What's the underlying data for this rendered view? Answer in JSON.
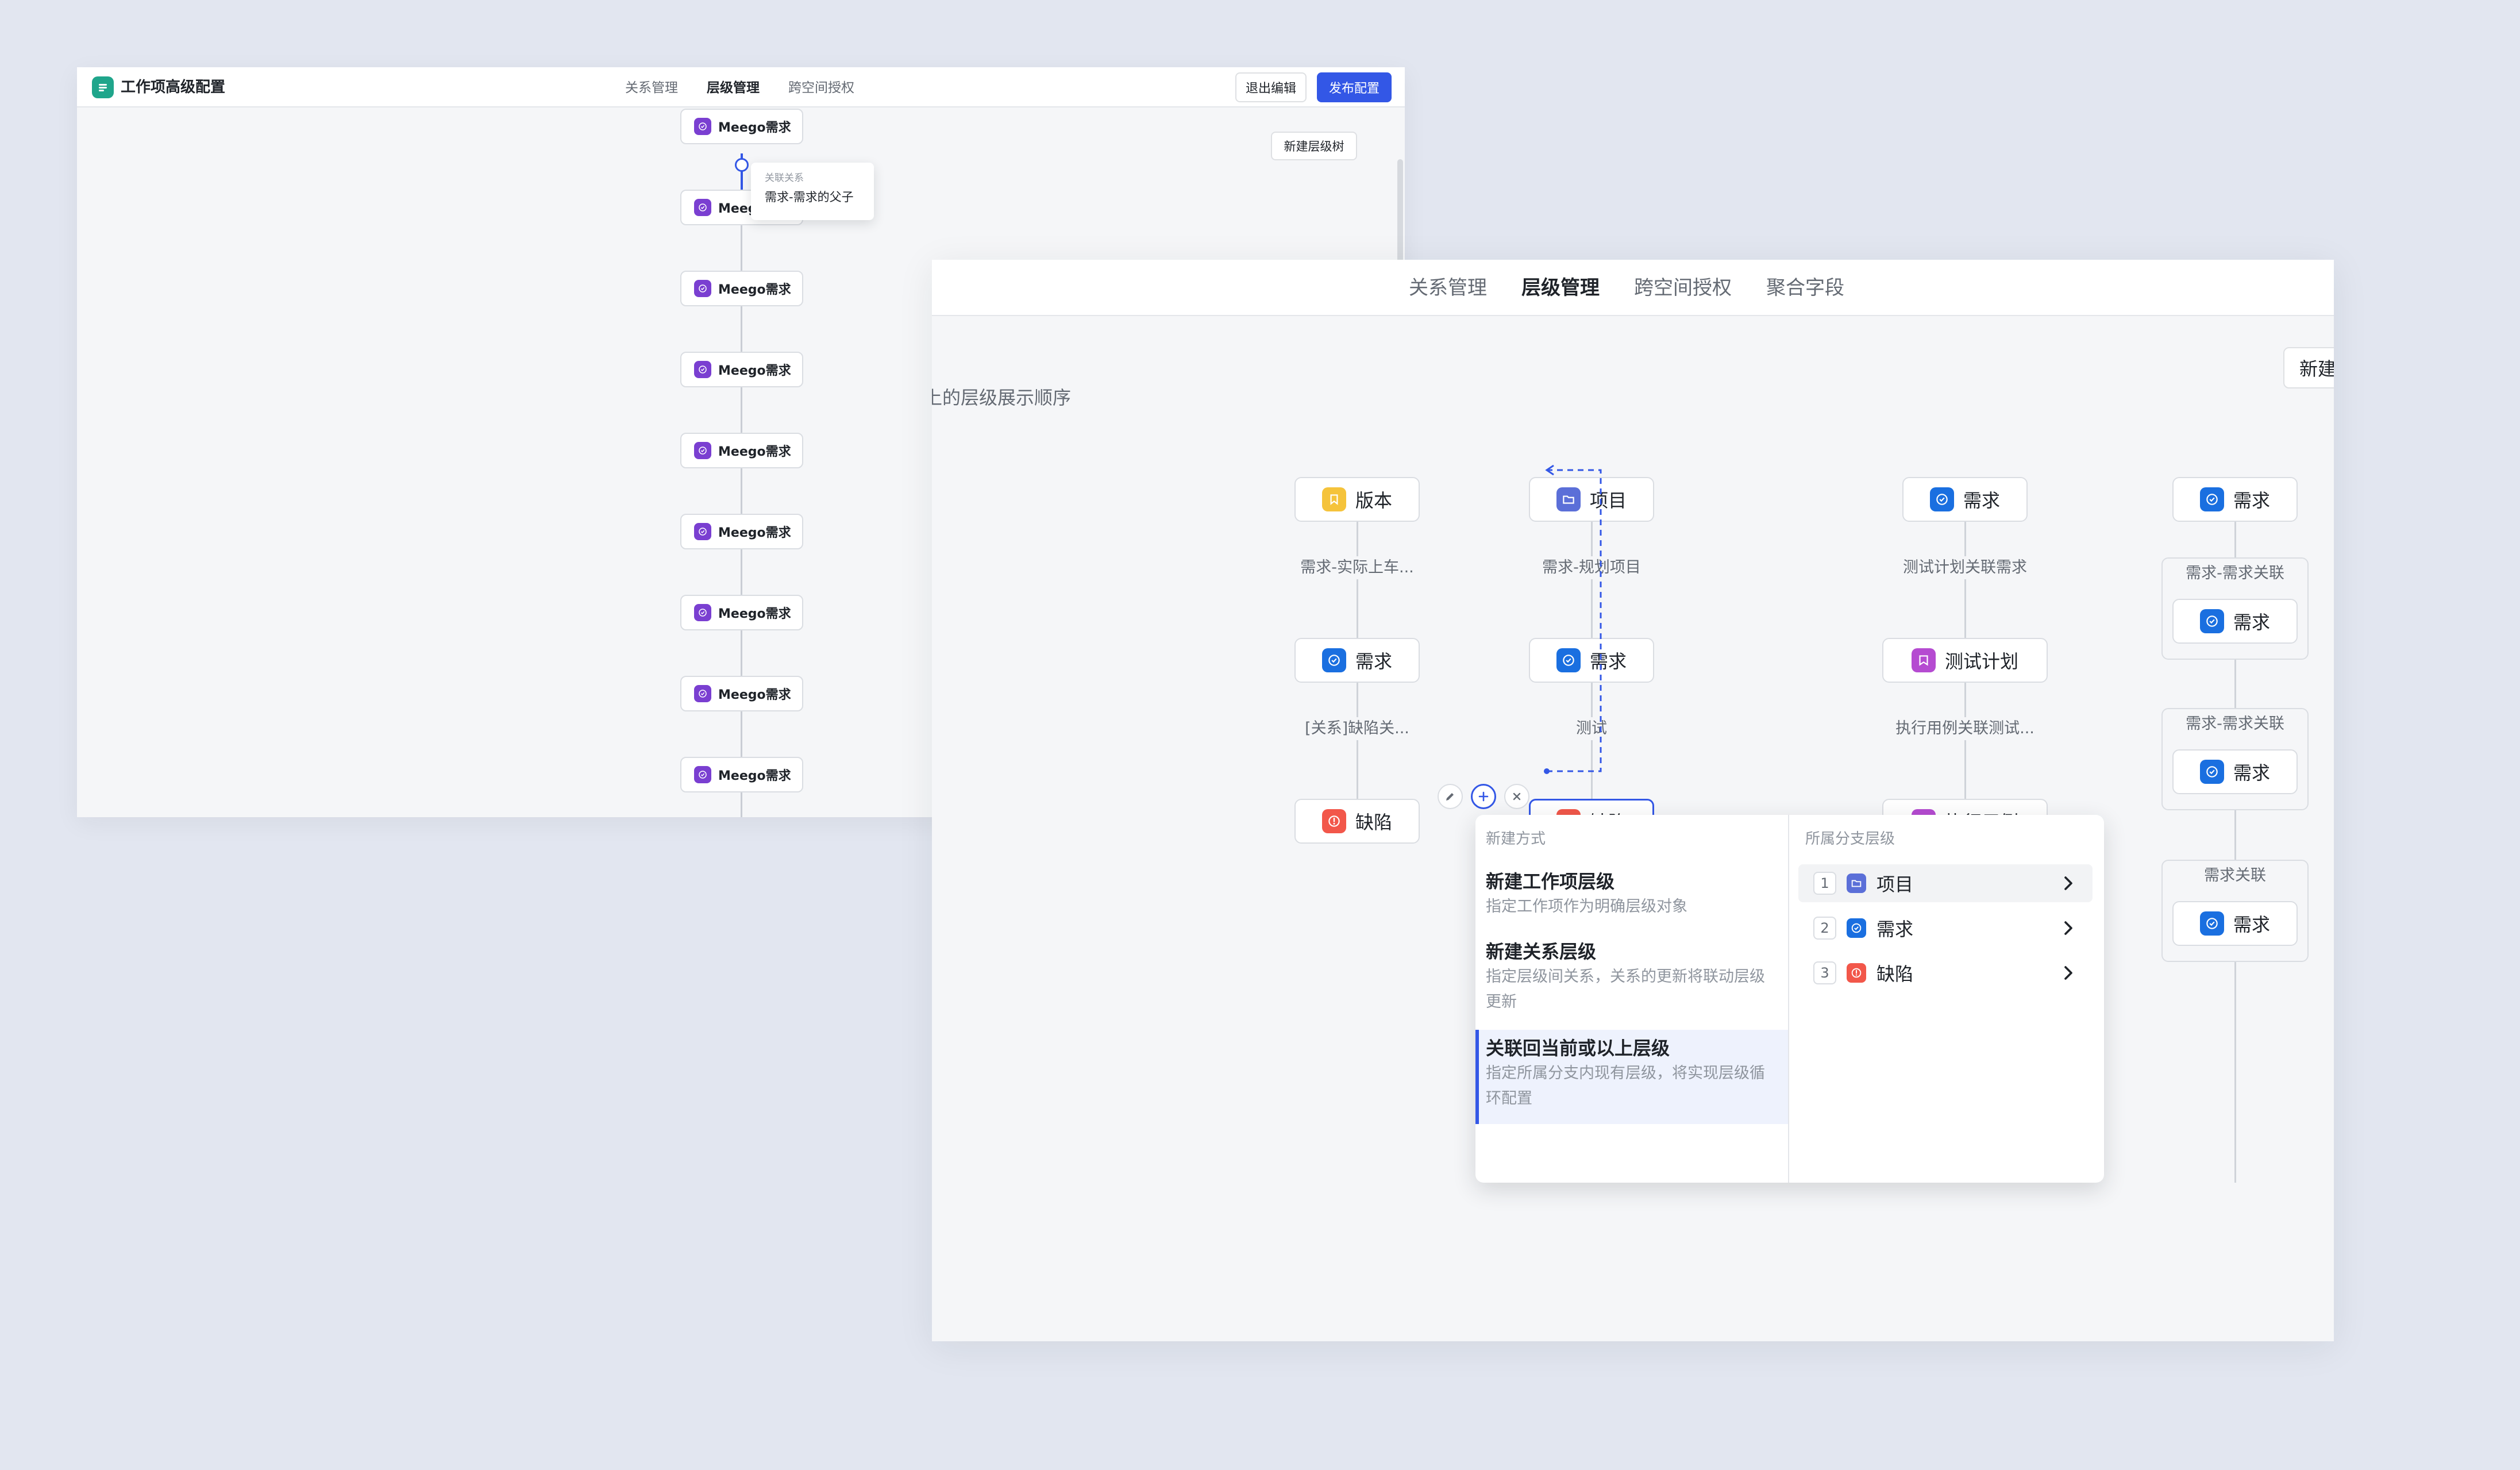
{
  "back": {
    "title": "工作项高级配置",
    "tabs": [
      "关系管理",
      "层级管理",
      "跨空间授权"
    ],
    "exit_label": "退出编辑",
    "publish_label": "发布配置",
    "new_tree_label": "新建层级树",
    "node_label": "Meego需求",
    "tooltip": {
      "title": "关联关系",
      "value": "需求-需求的父子"
    }
  },
  "front": {
    "tabs": [
      "关系管理",
      "层级管理",
      "跨空间授权",
      "聚合字段"
    ],
    "new_label": "新建",
    "hint": "上的层级展示顺序",
    "columns": [
      {
        "nodes": [
          "版本",
          "需求",
          "缺陷"
        ],
        "links": [
          "需求-实际上车...",
          "[关系]缺陷关..."
        ]
      },
      {
        "nodes": [
          "项目",
          "需求",
          "缺陷"
        ],
        "links": [
          "需求-规划项目",
          "测试"
        ]
      },
      {
        "nodes": [
          "需求",
          "测试计划",
          "执行用例"
        ],
        "links": [
          "测试计划关联需求",
          "执行用例关联测试..."
        ]
      },
      {
        "nodes": [
          "需求",
          "需求",
          "需求",
          "需求"
        ],
        "links": [
          "需求-需求关联",
          "需求-需求关联",
          "需求关联"
        ]
      }
    ],
    "popup": {
      "left_header": "新建方式",
      "options": [
        {
          "title": "新建工作项层级",
          "desc": "指定工作项作为明确层级对象"
        },
        {
          "title": "新建关系层级",
          "desc": "指定层级间关系，关系的更新将联动层级更新"
        },
        {
          "title": "关联回当前或以上层级",
          "desc": "指定所属分支内现有层级，将实现层级循环配置"
        }
      ],
      "right_header": "所属分支层级",
      "branch": [
        {
          "num": "1",
          "name": "项目"
        },
        {
          "num": "2",
          "name": "需求"
        },
        {
          "num": "3",
          "name": "缺陷"
        }
      ]
    }
  },
  "colors": {
    "accent": "#3357e6",
    "version": "#f5c33b",
    "project": "#5b6fd8",
    "story": "#1a6fe0",
    "defect": "#f2574a",
    "testplan": "#b54bd1",
    "meego": "#7a3fd1"
  }
}
